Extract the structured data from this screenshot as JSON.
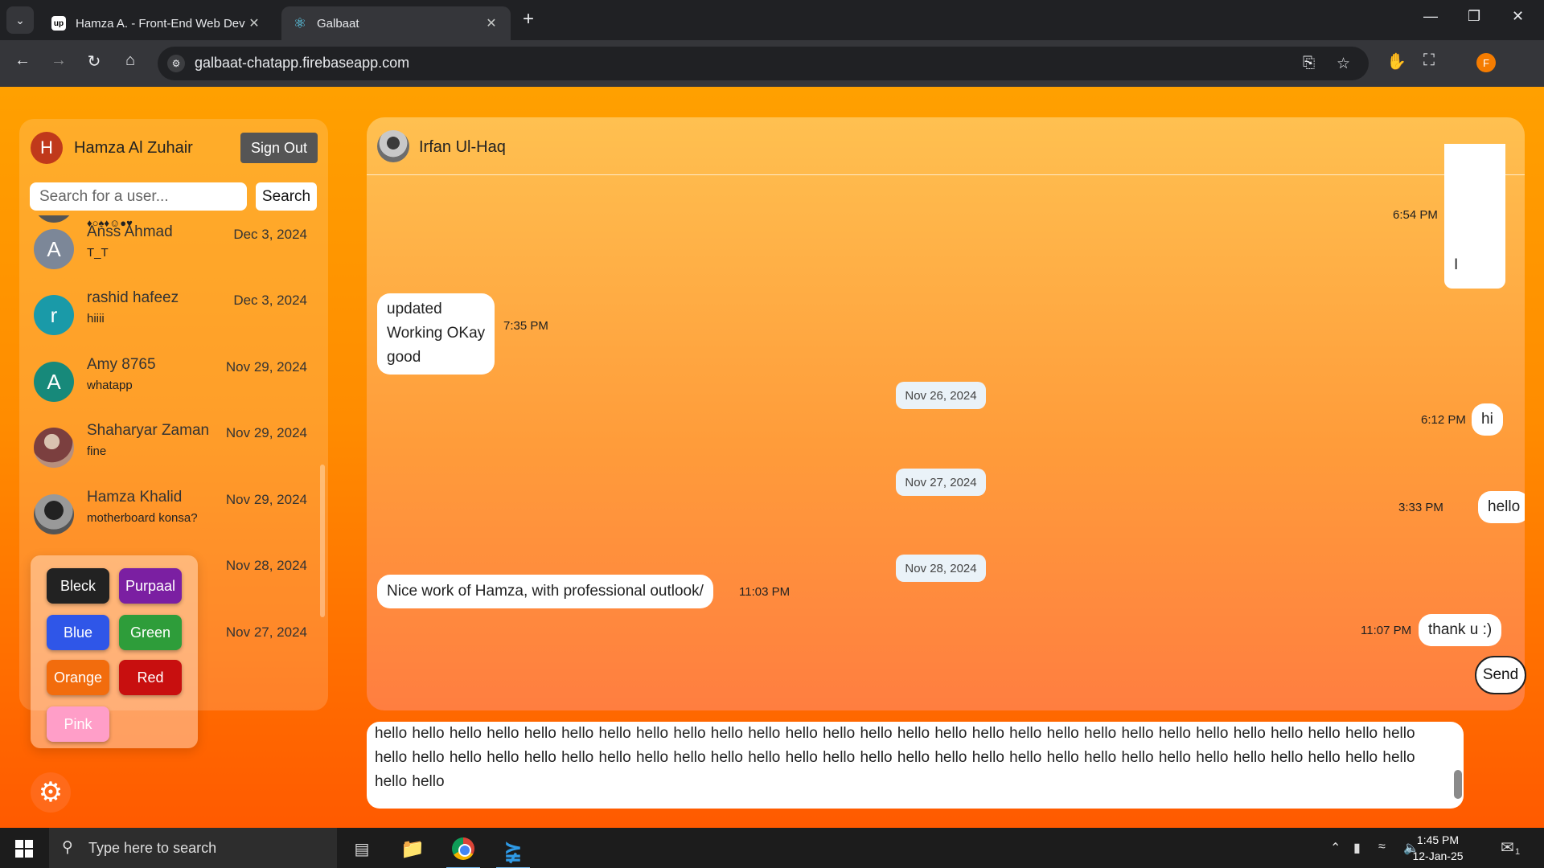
{
  "browser": {
    "tabs": [
      {
        "label": "Hamza A. - Front-End Web Dev",
        "favicon": "upwork-icon",
        "active": false
      },
      {
        "label": "Galbaat",
        "favicon": "react-icon",
        "active": true
      }
    ],
    "new_tab": "+",
    "url": "galbaat-chatapp.firebaseapp.com",
    "profile_initial": "F"
  },
  "sidebar": {
    "user": {
      "initial": "H",
      "name": "Hamza Al Zuhair",
      "avatar_color": "#c0391b"
    },
    "signout_label": "Sign Out",
    "search": {
      "placeholder": "Search for a user...",
      "button_label": "Search"
    },
    "chats": [
      {
        "initial": "",
        "name": "",
        "last_message": "",
        "date": "",
        "avatar_color": "#555555"
      },
      {
        "initial": "A",
        "name": "Anss Ahmad",
        "last_message": "T_T",
        "date": "Dec 3, 2024",
        "avatar_color": "#7c8798"
      },
      {
        "initial": "r",
        "name": "rashid hafeez",
        "last_message": "hiiii",
        "date": "Dec 3, 2024",
        "avatar_color": "#1a9aa8"
      },
      {
        "initial": "A",
        "name": "Amy 8765",
        "last_message": "whatapp",
        "date": "Nov 29, 2024",
        "avatar_color": "#17897a"
      },
      {
        "initial": "",
        "name": "Shaharyar Zaman",
        "last_message": "fine",
        "date": "Nov 29, 2024",
        "avatar_color": "photo"
      },
      {
        "initial": "",
        "name": "Hamza Khalid",
        "last_message": "motherboard konsa?",
        "date": "Nov 29, 2024",
        "avatar_color": "photo"
      },
      {
        "initial": "",
        "name": "",
        "last_message": "",
        "date": "Nov 28, 2024",
        "avatar_color": "#444444"
      },
      {
        "initial": "",
        "name": "",
        "last_message": "",
        "date": "Nov 27, 2024",
        "avatar_color": "#444444"
      }
    ],
    "themes": [
      {
        "label": "Bleck",
        "color": "#222222"
      },
      {
        "label": "Purpaal",
        "color": "#7b1fa2"
      },
      {
        "label": "Blue",
        "color": "#2f56e8"
      },
      {
        "label": "Green",
        "color": "#2e9d3a"
      },
      {
        "label": "Orange",
        "color": "#f26c0d"
      },
      {
        "label": "Red",
        "color": "#c80f0f"
      },
      {
        "label": "Pink",
        "color": "#ff9ec8"
      }
    ]
  },
  "chat": {
    "contact_name": "Irfan Ul-Haq",
    "messages": [
      {
        "side": "right",
        "lines": [
          "I"
        ],
        "time": "6:54 PM"
      },
      {
        "side": "left",
        "lines": [
          "updated",
          "Working OKay",
          "good"
        ],
        "time": "7:35 PM"
      },
      {
        "type": "date",
        "label": "Nov 26, 2024"
      },
      {
        "side": "right",
        "lines": [
          "hi"
        ],
        "time": "6:12 PM"
      },
      {
        "type": "date",
        "label": "Nov 27, 2024"
      },
      {
        "side": "right",
        "lines": [
          "hello"
        ],
        "time": "3:33 PM"
      },
      {
        "type": "date",
        "label": "Nov 28, 2024"
      },
      {
        "side": "left",
        "lines": [
          "Nice work of Hamza, with professional outlook/"
        ],
        "time": "11:03 PM"
      },
      {
        "side": "right",
        "lines": [
          "thank u :)"
        ],
        "time": "11:07 PM"
      }
    ],
    "composer_text": "hello hello hello hello hello hello hello hello hello hello hello hello hello hello hello hello hello hello hello hello hello hello hello hello hello hello hello hello hello hello hello hello hello hello hello hello hello hello hello hello hello hello hello hello hello hello hello hello hello hello hello hello hello hello hello hello hello hello hello hello hello hello hello hello hello hello hello hello hello hello hello hello hello hello hello hello hello hello hello hello hello hello hello hello hello hello",
    "send_label": "Send"
  },
  "taskbar": {
    "search_placeholder": "Type here to search",
    "time": "1:45 PM",
    "date": "12-Jan-25",
    "notification_count": "1"
  }
}
